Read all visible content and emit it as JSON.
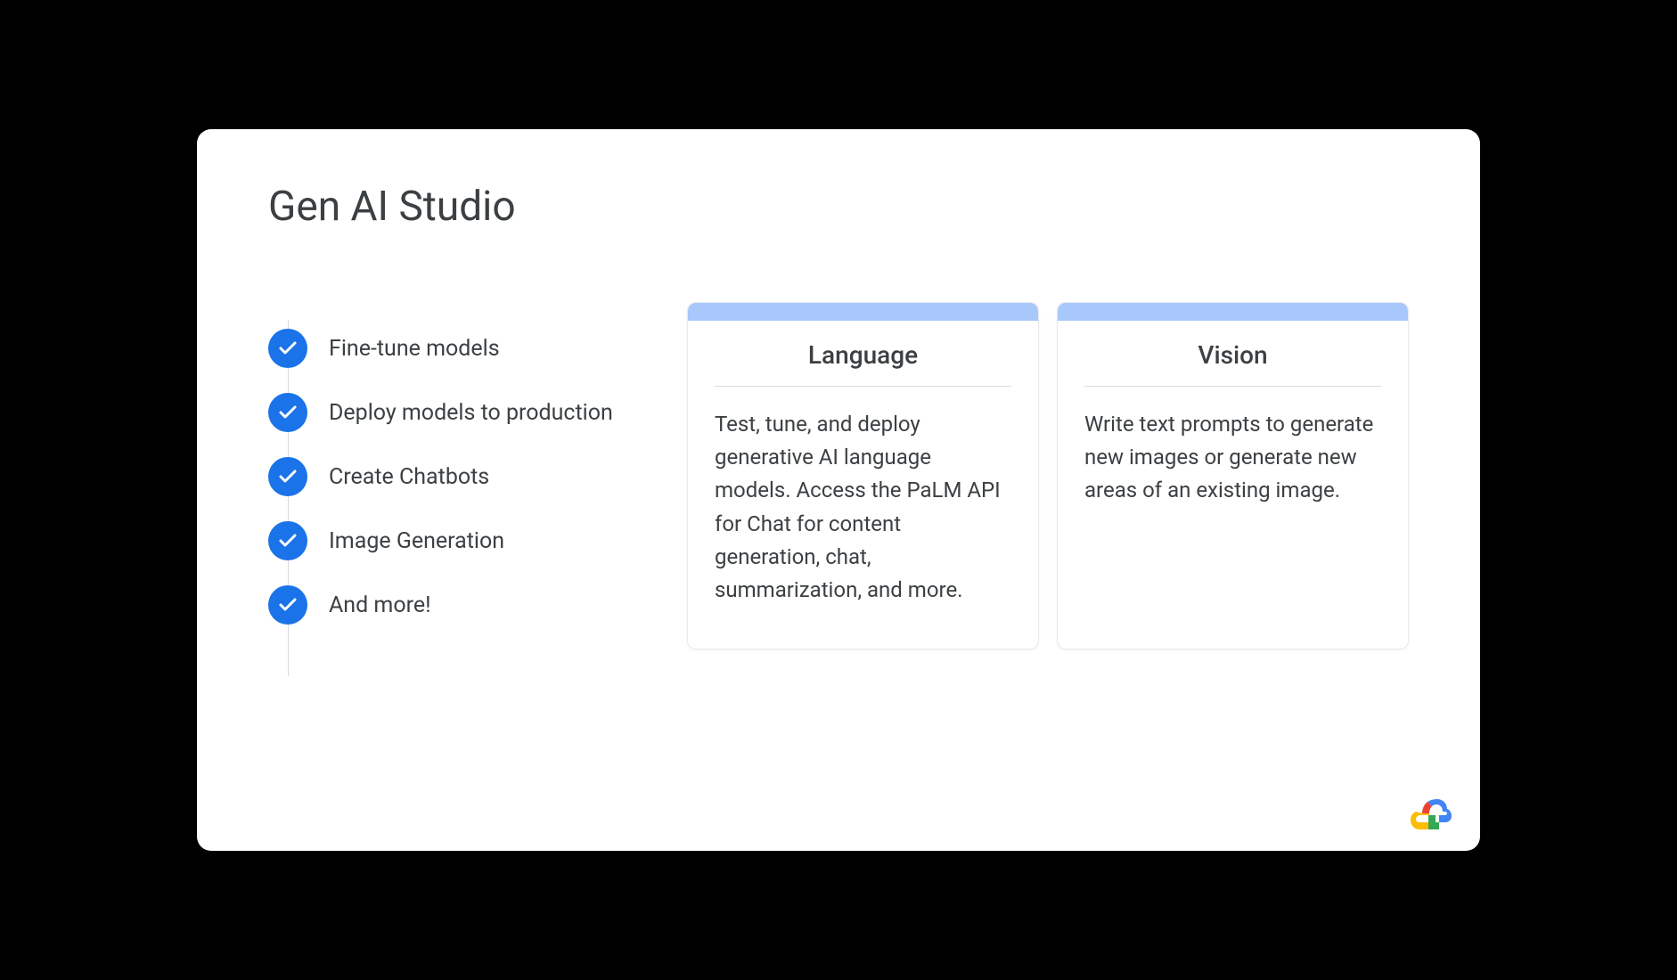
{
  "title": "Gen AI Studio",
  "features": [
    "Fine-tune models",
    "Deploy models to production",
    "Create Chatbots",
    "Image Generation",
    "And more!"
  ],
  "cards": [
    {
      "title": "Language",
      "description": "Test, tune, and deploy generative AI language models. Access the PaLM API for Chat for content generation, chat, summarization, and more."
    },
    {
      "title": "Vision",
      "description": "Write text prompts to generate new images or generate new areas of an existing image."
    }
  ]
}
